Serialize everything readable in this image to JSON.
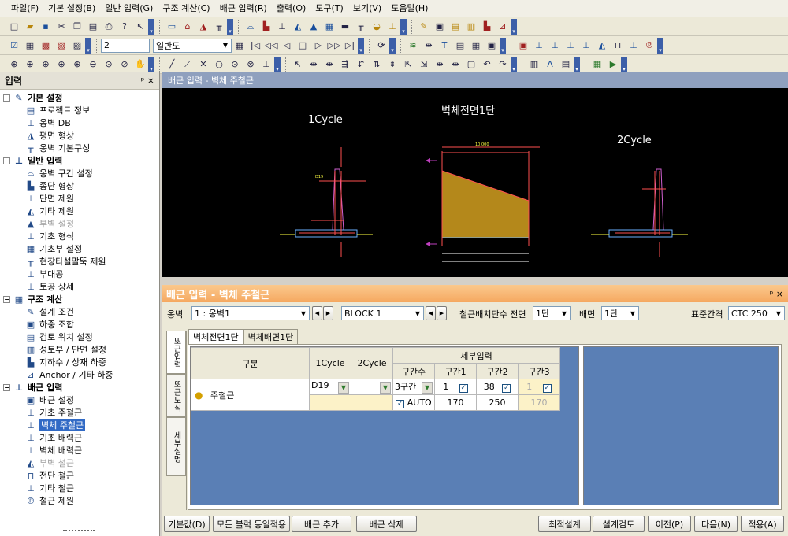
{
  "menu": [
    "파일(F)",
    "기본 설정(B)",
    "일반 입력(G)",
    "구조 계산(C)",
    "배근 입력(R)",
    "출력(O)",
    "도구(T)",
    "보기(V)",
    "도움말(H)"
  ],
  "toolbar": {
    "layer_number": "2",
    "view_combo": "일반도"
  },
  "left_panel": {
    "title": "입력",
    "pin": "ᵖ",
    "close": "×",
    "groups": [
      {
        "label": "기본 설정",
        "items": [
          {
            "label": "프로젝트 정보",
            "icon": "document-icon"
          },
          {
            "label": "옹벽  DB",
            "icon": "wall-icon"
          },
          {
            "label": "평면 형상",
            "icon": "plan-icon"
          },
          {
            "label": "옹벽 기본구성",
            "icon": "frame-icon"
          }
        ]
      },
      {
        "label": "일반 입력",
        "items": [
          {
            "label": "옹벽 구간 설정",
            "icon": "section-icon"
          },
          {
            "label": "종단 형상",
            "icon": "profile-icon"
          },
          {
            "label": "단면 제원",
            "icon": "cross-section-icon"
          },
          {
            "label": "기타 제원",
            "icon": "misc-icon"
          },
          {
            "label": "부벽 설정",
            "icon": "buttress-icon",
            "disabled": true
          },
          {
            "label": "기초 형식",
            "icon": "footing-icon"
          },
          {
            "label": "기초부 설정",
            "icon": "footing-setting-icon"
          },
          {
            "label": "현장타설말뚝 제원",
            "icon": "pile-icon"
          },
          {
            "label": "부대공",
            "icon": "auxiliary-icon"
          },
          {
            "label": "토공 상세",
            "icon": "earthwork-icon"
          }
        ]
      },
      {
        "label": "구조 계산",
        "items": [
          {
            "label": "설계 조건",
            "icon": "condition-icon"
          },
          {
            "label": "하중 조합",
            "icon": "load-combo-icon"
          },
          {
            "label": "검토 위치 설정",
            "icon": "check-position-icon"
          },
          {
            "label": "성토부 / 단면 설정",
            "icon": "fill-section-icon"
          },
          {
            "label": "지하수 / 상재 하중",
            "icon": "groundwater-icon"
          },
          {
            "label": "Anchor / 기타 하중",
            "icon": "anchor-icon"
          }
        ]
      },
      {
        "label": "배근 입력",
        "items": [
          {
            "label": "배근 설정",
            "icon": "rebar-setting-icon"
          },
          {
            "label": "기초 주철근",
            "icon": "footing-main-rebar-icon"
          },
          {
            "label": "벽체 주철근",
            "icon": "wall-main-rebar-icon",
            "selected": true
          },
          {
            "label": "기초 배력근",
            "icon": "footing-dist-rebar-icon"
          },
          {
            "label": "벽체 배력근",
            "icon": "wall-dist-rebar-icon"
          },
          {
            "label": "부벽 철근",
            "icon": "buttress-rebar-icon",
            "disabled": true
          },
          {
            "label": "전단 철근",
            "icon": "shear-rebar-icon"
          },
          {
            "label": "기타 철근",
            "icon": "other-rebar-icon"
          },
          {
            "label": "철근 제원",
            "icon": "rebar-spec-icon"
          }
        ]
      }
    ]
  },
  "drawing": {
    "title": "배근 입력 - 벽체 주철근",
    "labels": {
      "cycle1": "1Cycle",
      "front": "벽체전면1단",
      "cycle2": "2Cycle"
    }
  },
  "panel": {
    "title": "배근 입력 - 벽체 주철근",
    "wall_label": "옹벽",
    "wall_value": "1 : 옹벽1",
    "block_value": "BLOCK  1",
    "layer_label": "철근배치단수 전면",
    "front_value": "1단",
    "back_label": "배면",
    "back_value": "1단",
    "ctc_label": "표준간격",
    "ctc_value": "CTC 250",
    "vtabs": [
      "또근입력",
      "또근도식",
      "세부설명"
    ],
    "tabs": [
      "벽체전면1단",
      "벽체배면1단"
    ],
    "grid": {
      "headers": {
        "type": "구분",
        "c1": "1Cycle",
        "c2": "2Cycle",
        "detail": "세부입력",
        "count": "구간수",
        "s1": "구간1",
        "s2": "구간2",
        "s3": "구간3"
      },
      "row_label": "주철근",
      "dia": "D19",
      "count": "3구간",
      "s1": "1",
      "s2": "38",
      "s3": "1",
      "auto": "AUTO",
      "v1": "170",
      "v2": "250",
      "v3": "170"
    },
    "buttons": {
      "default": "기본값(D)",
      "apply_all": "모든 블럭 동일적용",
      "add": "배근 추가",
      "delete": "배근 삭제",
      "optimize": "최적설계",
      "review": "설계검토",
      "prev": "이전(P)",
      "next": "다음(N)",
      "apply": "적용(A)"
    }
  }
}
